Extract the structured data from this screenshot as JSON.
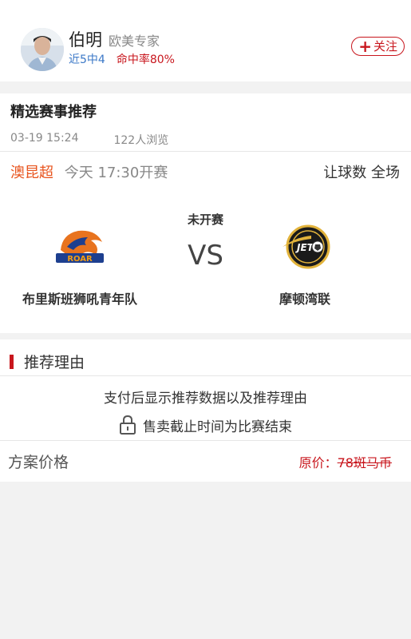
{
  "expert": {
    "name": "伯明",
    "title": "欧美专家",
    "recent_record": "近5中4",
    "hit_rate": "命中率80%",
    "follow_icon": "plus-icon",
    "follow_label": "关注"
  },
  "article": {
    "heading": "精选赛事推荐",
    "date": "03-19 15:24",
    "views": "122人浏览"
  },
  "match": {
    "league": "澳昆超",
    "kickoff": "今天 17:30开赛",
    "market": "让球数 全场",
    "status": "未开赛",
    "vs": "VS",
    "home_team": "布里斯班狮吼青年队",
    "away_team": "摩顿湾联",
    "home_logo_text": "ROAR",
    "away_logo_text": "JETS"
  },
  "reason": {
    "heading": "推荐理由",
    "pay_hint": "支付后显示推荐数据以及推荐理由",
    "deadline_icon": "lock-icon",
    "deadline_text": "售卖截止时间为比赛结束"
  },
  "price": {
    "label": "方案价格",
    "original_label": "原价：",
    "original_value": "78斑马币"
  },
  "colors": {
    "accent_red": "#c8161d",
    "league_orange": "#e8541e",
    "stat_blue": "#3b78c7"
  }
}
